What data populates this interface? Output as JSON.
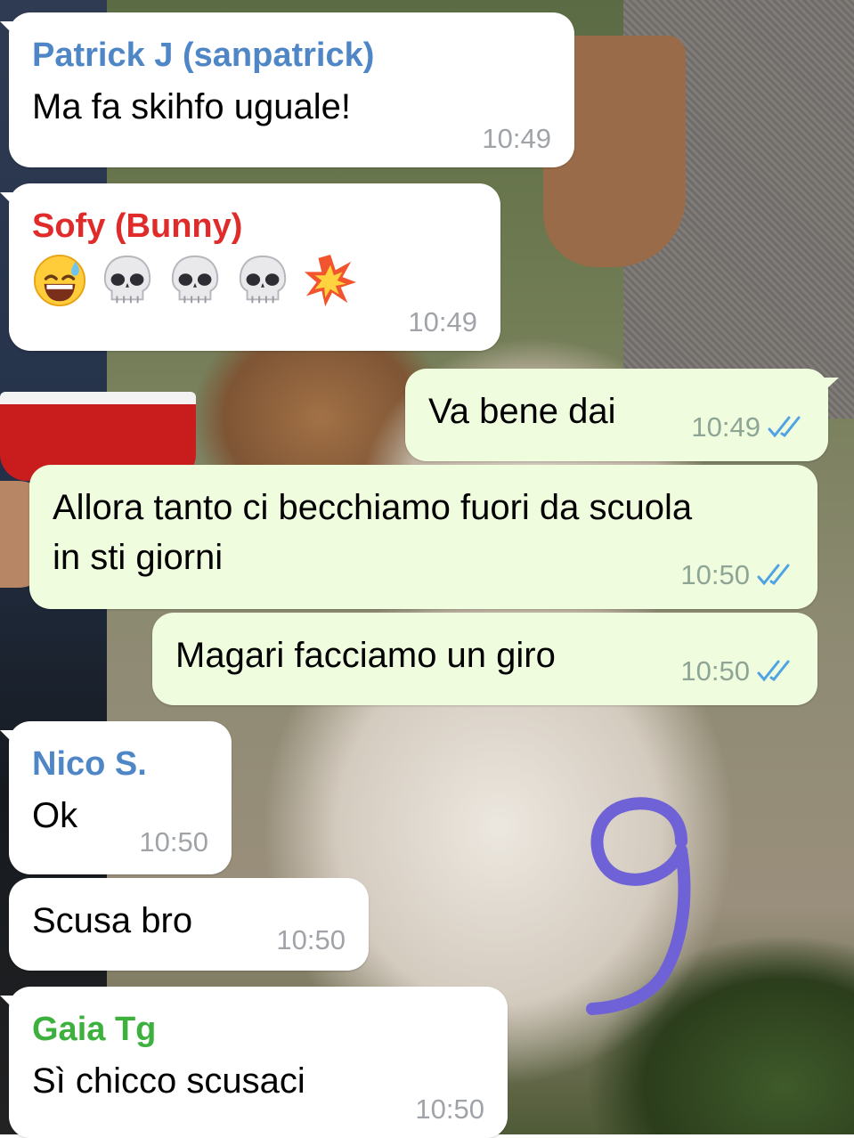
{
  "messages": [
    {
      "sender": "Patrick J (sanpatrick)",
      "sender_color": "#4f86c6",
      "text": "Ma fa skihfo uguale!",
      "time": "10:49"
    },
    {
      "sender": "Sofy (Bunny)",
      "sender_color": "#e02b2b",
      "emojis": [
        "sweat-smile-emoji",
        "skull-emoji",
        "skull-emoji",
        "skull-emoji",
        "collision-emoji"
      ],
      "time": "10:49"
    },
    {
      "text": "Va bene dai",
      "time": "10:49",
      "read": true
    },
    {
      "text": "Allora tanto ci becchiamo fuori da scuola in sti giorni",
      "time": "10:50",
      "read": true
    },
    {
      "text": "Magari facciamo un giro",
      "time": "10:50",
      "read": true
    },
    {
      "sender": "Nico S.",
      "sender_color": "#4f86c6",
      "text": "Ok",
      "time": "10:50"
    },
    {
      "text": "Scusa bro",
      "time": "10:50"
    },
    {
      "sender": "Gaia Tg",
      "sender_color": "#3db03d",
      "text": "Sì chicco scusaci",
      "time": "10:50"
    }
  ],
  "overlay_annotation": {
    "text": "9",
    "color": "#6e62d6"
  },
  "colors": {
    "incoming_bubble": "#ffffff",
    "outgoing_bubble": "#effdde",
    "read_ticks": "#4fa3e3"
  }
}
